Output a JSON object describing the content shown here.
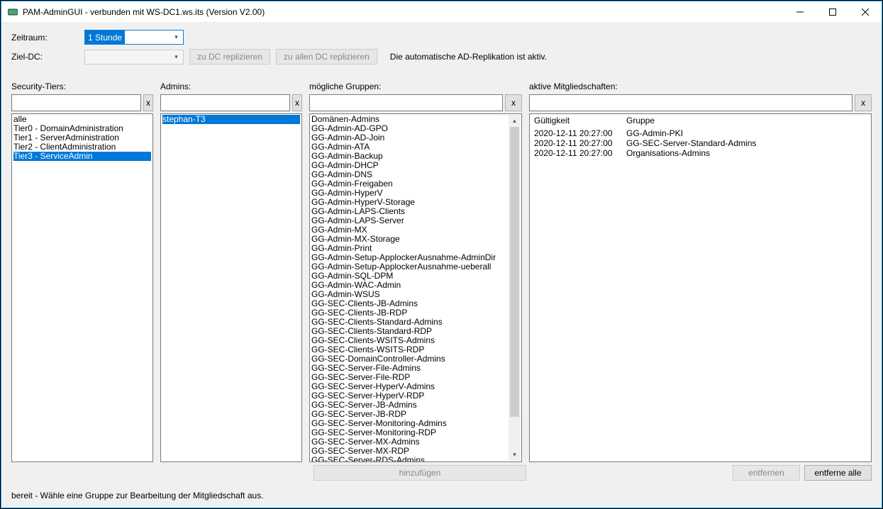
{
  "window": {
    "title": "PAM-AdminGUI - verbunden mit WS-DC1.ws.its (Version V2.00)"
  },
  "labels": {
    "zeitraum": "Zeitraum:",
    "zieldc": "Ziel-DC:",
    "securityTiers": "Security-Tiers:",
    "admins": "Admins:",
    "groups": "mögliche Gruppen:",
    "memberships": "aktive Mitgliedschaften:",
    "validity": "Gültigkeit",
    "group": "Gruppe"
  },
  "zeitraumValue": "1 Stunde",
  "buttons": {
    "replicateDC": "zu DC replizieren",
    "replicateAll": "zu allen DC replizieren",
    "add": "hinzufügen",
    "remove": "entfernen",
    "removeAll": "entferne alle",
    "x": "x"
  },
  "replMessage": "Die automatische AD-Replikation ist aktiv.",
  "tiers": [
    "alle",
    "Tier0 - DomainAdministration",
    "Tier1 - ServerAdministration",
    "Tier2 - ClientAdministration",
    "Tier3 - ServiceAdmin"
  ],
  "tiersSelectedIndex": 4,
  "admins": [
    "stephan-T3"
  ],
  "adminsSelectedIndex": 0,
  "groups": [
    "Domänen-Admins",
    "GG-Admin-AD-GPO",
    "GG-Admin-AD-Join",
    "GG-Admin-ATA",
    "GG-Admin-Backup",
    "GG-Admin-DHCP",
    "GG-Admin-DNS",
    "GG-Admin-Freigaben",
    "GG-Admin-HyperV",
    "GG-Admin-HyperV-Storage",
    "GG-Admin-LAPS-Clients",
    "GG-Admin-LAPS-Server",
    "GG-Admin-MX",
    "GG-Admin-MX-Storage",
    "GG-Admin-Print",
    "GG-Admin-Setup-ApplockerAusnahme-AdminDir",
    "GG-Admin-Setup-ApplockerAusnahme-ueberall",
    "GG-Admin-SQL-DPM",
    "GG-Admin-WAC-Admin",
    "GG-Admin-WSUS",
    "GG-SEC-Clients-JB-Admins",
    "GG-SEC-Clients-JB-RDP",
    "GG-SEC-Clients-Standard-Admins",
    "GG-SEC-Clients-Standard-RDP",
    "GG-SEC-Clients-WSITS-Admins",
    "GG-SEC-Clients-WSITS-RDP",
    "GG-SEC-DomainController-Admins",
    "GG-SEC-Server-File-Admins",
    "GG-SEC-Server-File-RDP",
    "GG-SEC-Server-HyperV-Admins",
    "GG-SEC-Server-HyperV-RDP",
    "GG-SEC-Server-JB-Admins",
    "GG-SEC-Server-JB-RDP",
    "GG-SEC-Server-Monitoring-Admins",
    "GG-SEC-Server-Monitoring-RDP",
    "GG-SEC-Server-MX-Admins",
    "GG-SEC-Server-MX-RDP",
    "GG-SEC-Server-RDS-Admins"
  ],
  "memberships": [
    {
      "validity": "2020-12-11 20:27:00",
      "group": "GG-Admin-PKI"
    },
    {
      "validity": "2020-12-11 20:27:00",
      "group": "GG-SEC-Server-Standard-Admins"
    },
    {
      "validity": "2020-12-11 20:27:00",
      "group": "Organisations-Admins"
    }
  ],
  "status": "bereit - Wähle eine Gruppe zur Bearbeitung der Mitgliedschaft aus."
}
